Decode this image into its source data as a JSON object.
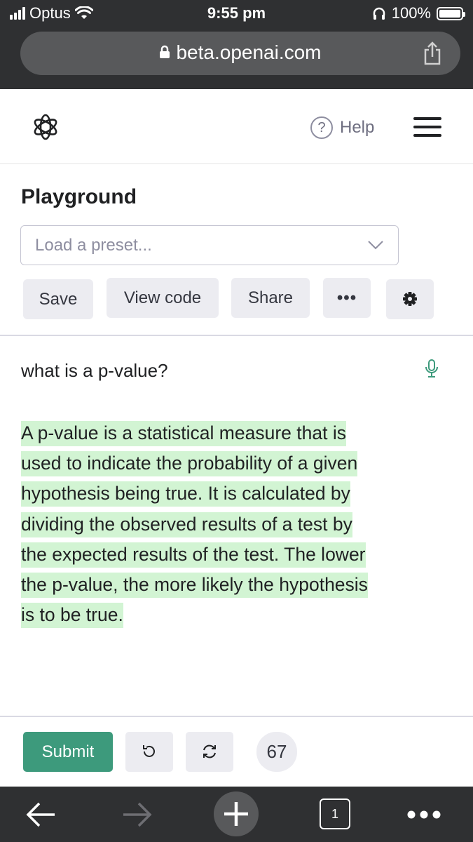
{
  "status_bar": {
    "carrier": "Optus",
    "time": "9:55 pm",
    "battery": "100%",
    "icons": [
      "signal-icon",
      "wifi-icon",
      "headphones-icon",
      "battery-icon"
    ]
  },
  "address_bar": {
    "url": "beta.openai.com",
    "icons": [
      "lock-icon",
      "share-icon"
    ]
  },
  "header": {
    "logo_icon": "openai-logo-icon",
    "help_glyph": "?",
    "help_label": "Help",
    "menu_icon": "hamburger-menu-icon"
  },
  "playground": {
    "title": "Playground",
    "preset_placeholder": "Load a preset...",
    "buttons": {
      "save": "Save",
      "view_code": "View code",
      "share": "Share",
      "more": "•••",
      "settings_icon": "gear-icon"
    }
  },
  "editor": {
    "prompt": "what is a p-value?",
    "mic_icon": "microphone-icon",
    "completion_lines": [
      "A p-value is a statistical measure that is",
      "used to indicate the probability of a given",
      "hypothesis being true. It is calculated by",
      "dividing the observed results of a test by",
      "the expected results of the test. The lower",
      "the p-value, the more likely the hypothesis",
      "is to be true."
    ],
    "highlight_color": "#d2f4d3"
  },
  "controls": {
    "submit": "Submit",
    "undo_icon": "undo-icon",
    "regenerate_icon": "regenerate-icon",
    "token_count": "67"
  },
  "browser_toolbar": {
    "tab_count": "1",
    "icons": [
      "back-arrow-icon",
      "forward-arrow-icon",
      "plus-icon",
      "tabs-icon",
      "more-dots-icon"
    ]
  },
  "colors": {
    "accent": "#3d9a7c",
    "browser_chrome": "#2f3032",
    "button_bg": "#ececf1"
  }
}
